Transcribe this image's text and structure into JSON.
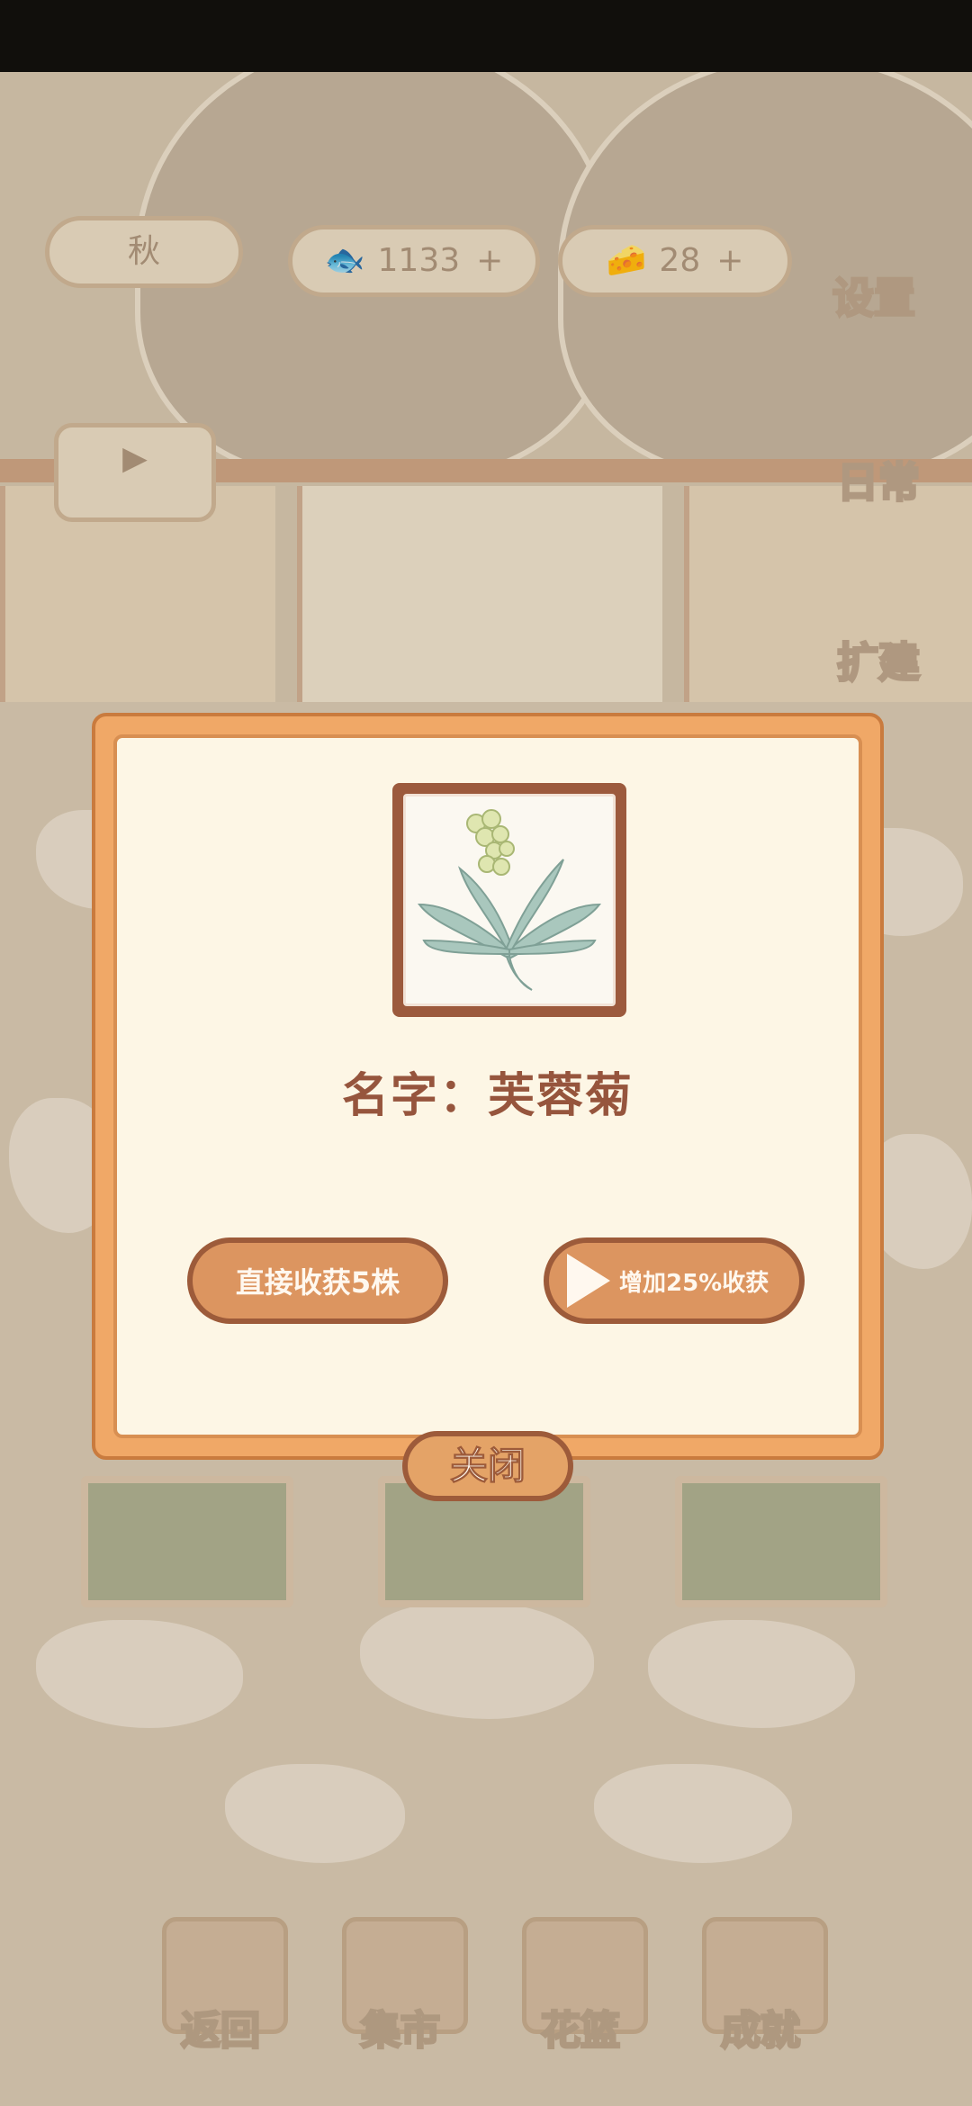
{
  "hud": {
    "season_label": "秋",
    "fish_count": "1133",
    "cheese_count": "28",
    "settings_label": "设置",
    "daily_label": "日常",
    "expand_label": "扩建"
  },
  "bottom_nav": [
    {
      "label": "返回"
    },
    {
      "label": "集市"
    },
    {
      "label": "花篮"
    },
    {
      "label": "成就"
    }
  ],
  "dialog": {
    "plant_name_text": "名字：芙蓉菊",
    "harvest_button_label": "直接收获5株",
    "ad_button_label": "增加25%收获",
    "close_button_label": "关闭"
  },
  "colors": {
    "dialog_border": "#f0a867",
    "dialog_fill": "#fdf6e5",
    "button_fill": "#dc9560",
    "button_outline": "#9d5b3a",
    "name_text": "#96553d"
  }
}
